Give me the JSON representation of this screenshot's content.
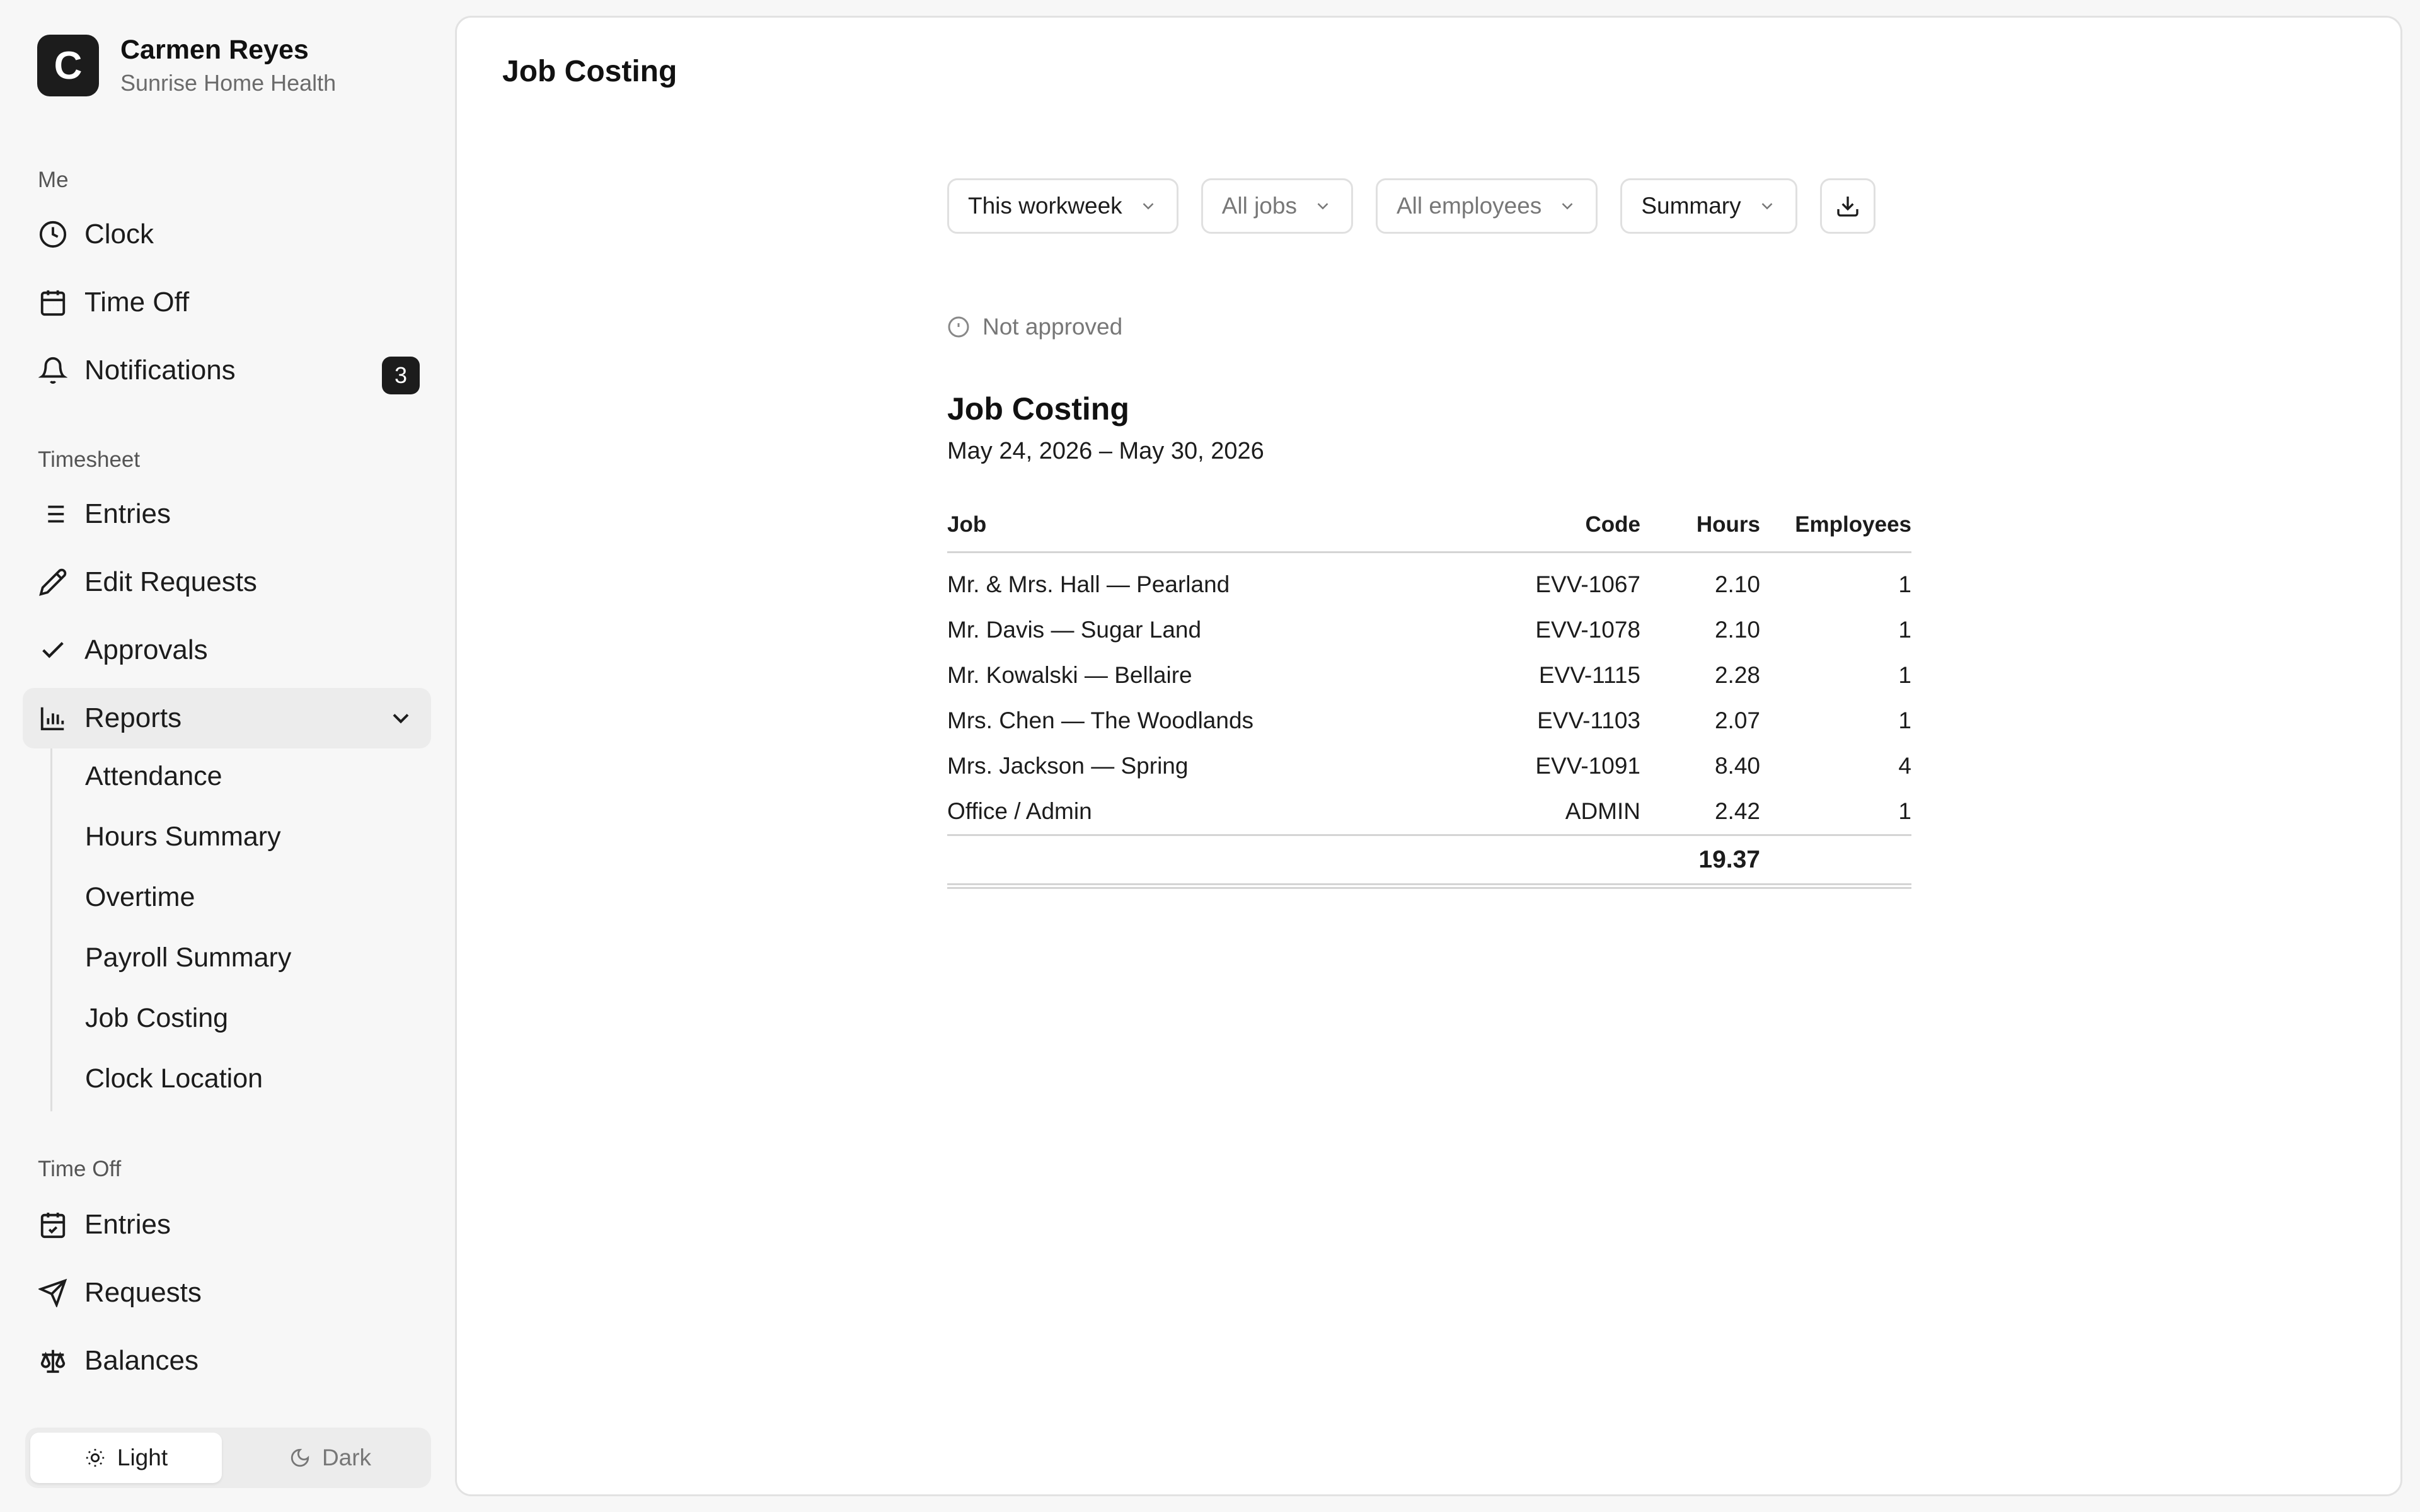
{
  "user": {
    "initial": "C",
    "name": "Carmen Reyes",
    "org": "Sunrise Home Health"
  },
  "sidebar": {
    "me_label": "Me",
    "me_items": [
      {
        "label": "Clock",
        "icon": "clock-icon"
      },
      {
        "label": "Time Off",
        "icon": "calendar-icon"
      },
      {
        "label": "Notifications",
        "icon": "bell-icon",
        "badge": "3"
      }
    ],
    "timesheet_label": "Timesheet",
    "timesheet_items": [
      {
        "label": "Entries",
        "icon": "list-icon"
      },
      {
        "label": "Edit Requests",
        "icon": "pencil-icon"
      },
      {
        "label": "Approvals",
        "icon": "check-icon"
      },
      {
        "label": "Reports",
        "icon": "bar-chart-icon",
        "expanded": true
      }
    ],
    "report_items": [
      "Attendance",
      "Hours Summary",
      "Overtime",
      "Payroll Summary",
      "Job Costing",
      "Clock Location"
    ],
    "timeoff_label": "Time Off",
    "timeoff_items": [
      {
        "label": "Entries",
        "icon": "calendar-check-icon"
      },
      {
        "label": "Requests",
        "icon": "send-icon"
      },
      {
        "label": "Balances",
        "icon": "scale-icon"
      }
    ],
    "theme": {
      "light": "Light",
      "dark": "Dark",
      "selected": "Light"
    }
  },
  "main": {
    "title": "Job Costing",
    "filters": {
      "period": "This workweek",
      "jobs": "All jobs",
      "employees": "All employees",
      "view": "Summary"
    },
    "status": "Not approved",
    "report": {
      "title": "Job Costing",
      "range": "May 24, 2026 – May 30, 2026",
      "columns": {
        "job": "Job",
        "code": "Code",
        "hours": "Hours",
        "employees": "Employees"
      },
      "rows": [
        {
          "job": "Mr. & Mrs. Hall — Pearland",
          "code": "EVV-1067",
          "hours": "2.10",
          "employees": "1"
        },
        {
          "job": "Mr. Davis — Sugar Land",
          "code": "EVV-1078",
          "hours": "2.10",
          "employees": "1"
        },
        {
          "job": "Mr. Kowalski — Bellaire",
          "code": "EVV-1115",
          "hours": "2.28",
          "employees": "1"
        },
        {
          "job": "Mrs. Chen — The Woodlands",
          "code": "EVV-1103",
          "hours": "2.07",
          "employees": "1"
        },
        {
          "job": "Mrs. Jackson — Spring",
          "code": "EVV-1091",
          "hours": "8.40",
          "employees": "4"
        },
        {
          "job": "Office / Admin",
          "code": "ADMIN",
          "hours": "2.42",
          "employees": "1"
        }
      ],
      "total_hours": "19.37"
    }
  }
}
